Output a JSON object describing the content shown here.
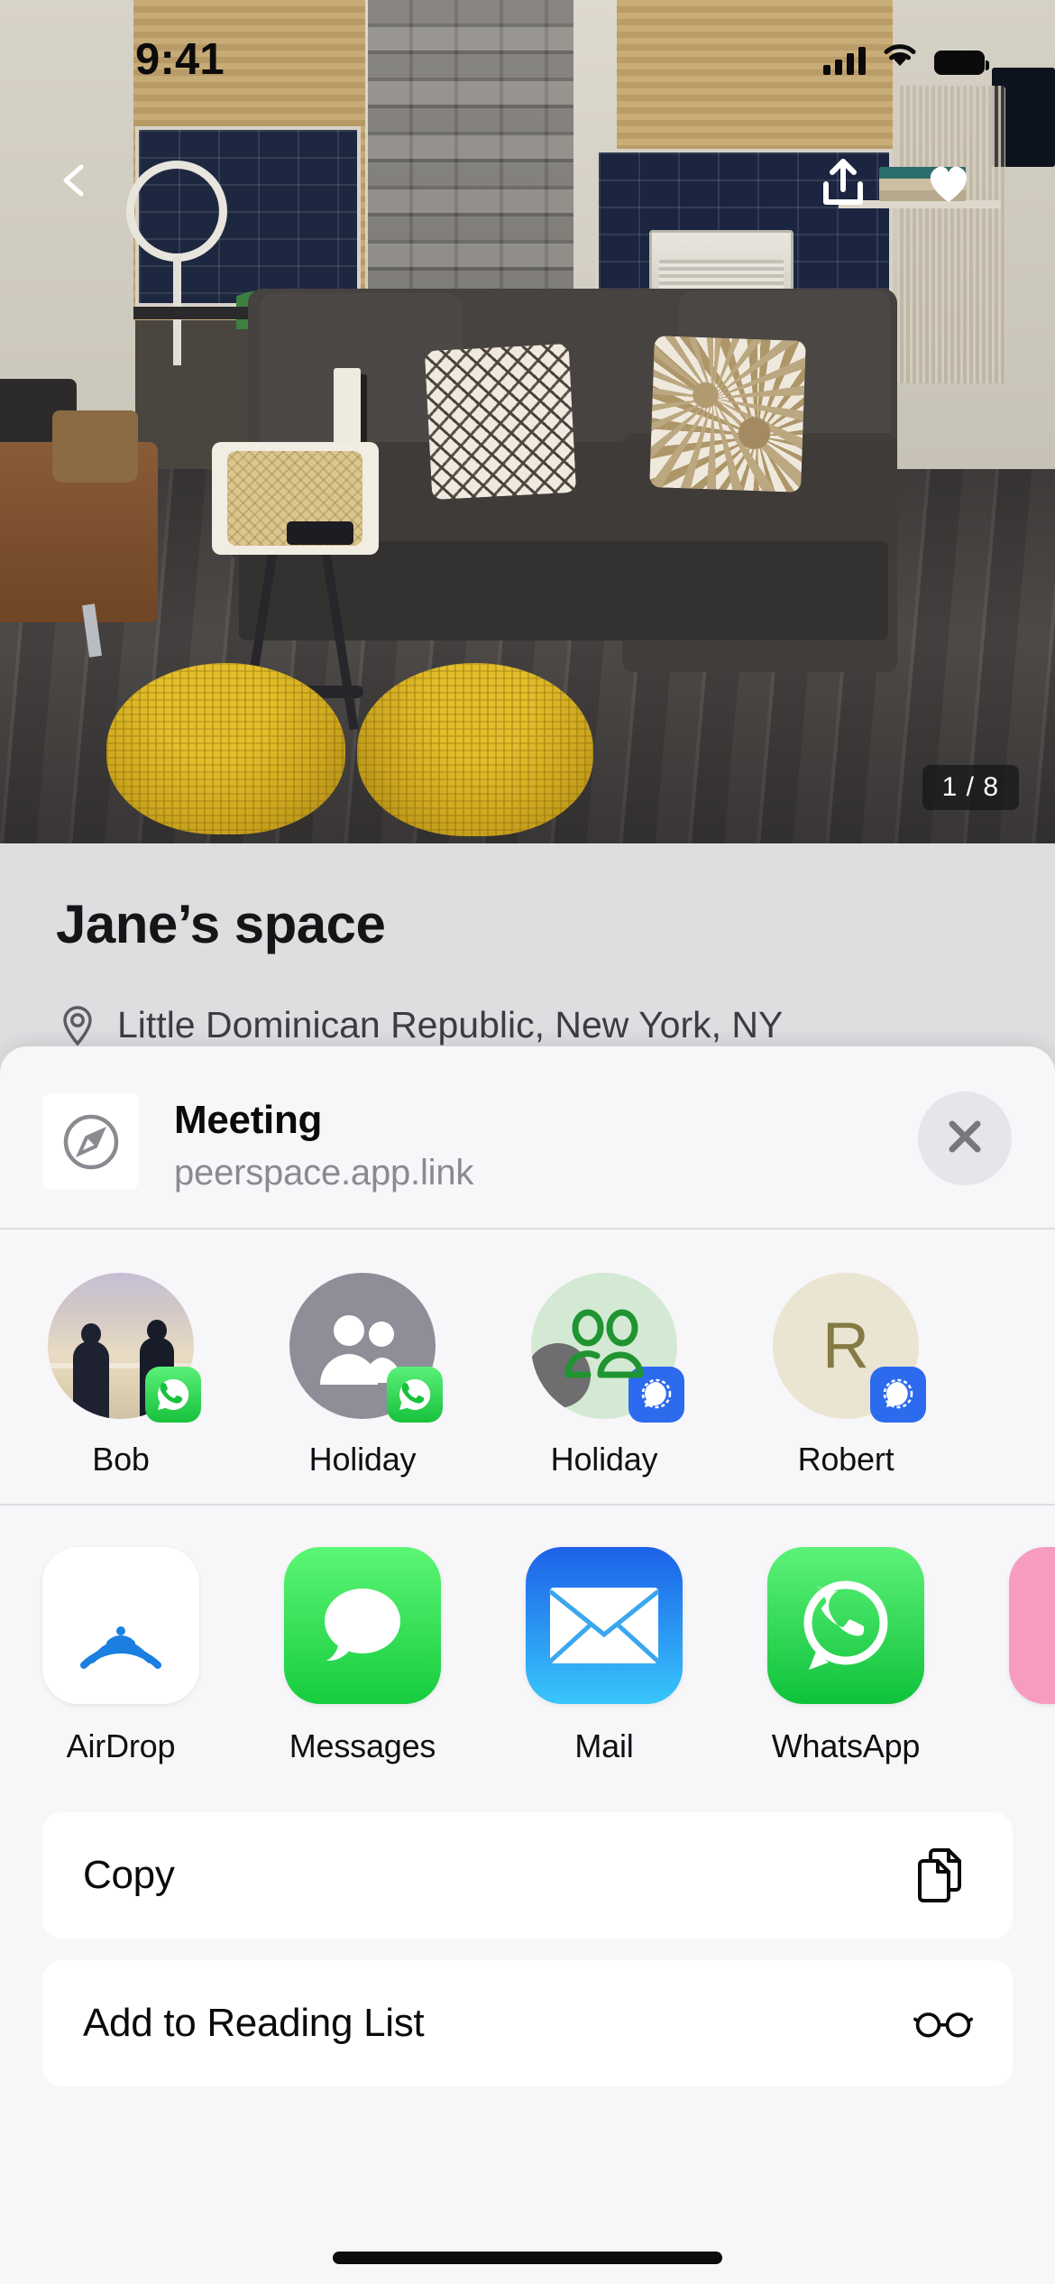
{
  "status_bar": {
    "time": "9:41",
    "signal_icon": "cellular-bars-icon",
    "wifi_icon": "wifi-icon",
    "battery_icon": "battery-icon"
  },
  "hero": {
    "back_icon": "back-chevron-icon",
    "share_icon": "share-upload-icon",
    "favorite_icon": "heart-filled-icon",
    "photo_counter": "1 / 8",
    "photo_alt": "living room with gray sectional sofa, white coffee table and two yellow knitted poufs"
  },
  "listing": {
    "title": "Jane’s space",
    "location_icon": "location-pin-icon",
    "location": "Little Dominican Republic, New York, NY"
  },
  "share_sheet": {
    "favicon_icon": "safari-compass-icon",
    "title": "Meeting",
    "subtitle": "peerspace.app.link",
    "close_icon": "close-x-icon",
    "contacts": [
      {
        "name": "Bob",
        "avatar_type": "photo",
        "avatar_icon": "contact-photo-avatar",
        "app_badge": "whatsapp-badge-icon",
        "badge_app": "WhatsApp"
      },
      {
        "name": "Holiday",
        "avatar_type": "group",
        "avatar_icon": "group-people-icon",
        "app_badge": "whatsapp-badge-icon",
        "badge_app": "WhatsApp"
      },
      {
        "name": "Holiday",
        "avatar_type": "group",
        "avatar_icon": "group-people-outline-icon",
        "app_badge": "signal-badge-icon",
        "badge_app": "Signal"
      },
      {
        "name": "Robert",
        "avatar_type": "initial",
        "avatar_letter": "R",
        "app_badge": "signal-badge-icon",
        "badge_app": "Signal"
      }
    ],
    "apps": [
      {
        "name": "AirDrop",
        "icon": "airdrop-icon"
      },
      {
        "name": "Messages",
        "icon": "messages-icon"
      },
      {
        "name": "Mail",
        "icon": "mail-icon"
      },
      {
        "name": "WhatsApp",
        "icon": "whatsapp-icon"
      },
      {
        "name": "",
        "icon": "pink-app-icon"
      }
    ],
    "actions": [
      {
        "label": "Copy",
        "icon": "copy-documents-icon"
      },
      {
        "label": "Add to Reading List",
        "icon": "glasses-icon"
      }
    ]
  },
  "colors": {
    "sheet_bg": "#f7f6f8",
    "row_bg": "#ffffff",
    "whatsapp_green": "#17c13c",
    "signal_blue": "#2c6bed",
    "messages_green": "#25cf41",
    "mail_blue": "#1c61e8",
    "pink_app": "#f79cc0",
    "text_primary": "#0a0a0c",
    "text_secondary": "#8a8a90"
  }
}
